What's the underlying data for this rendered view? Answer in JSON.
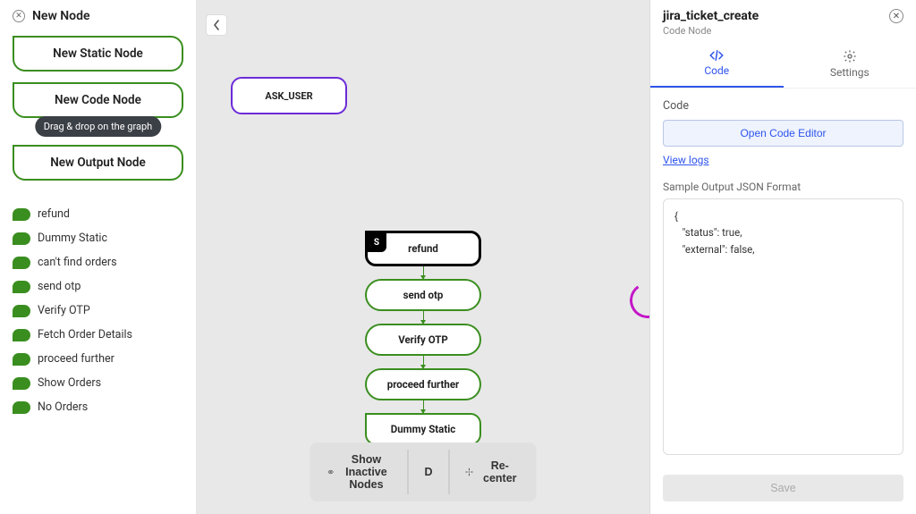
{
  "sidebar": {
    "title": "New Node",
    "buttons": {
      "static": "New Static Node",
      "code": "New Code Node",
      "output": "New Output Node"
    },
    "tooltip": "Drag & drop on the graph",
    "nodes": [
      "refund",
      "Dummy Static",
      "can't find orders",
      "send otp",
      "Verify OTP",
      "Fetch Order Details",
      "proceed further",
      "Show Orders",
      "No Orders"
    ]
  },
  "canvas": {
    "ask_user": "ASK_USER",
    "refund_tag": "S",
    "flow": [
      "refund",
      "send otp",
      "Verify OTP",
      "proceed further",
      "Dummy Static"
    ],
    "toolbar": {
      "inactive": "Show Inactive Nodes",
      "d": "D",
      "recenter": "Re-center"
    }
  },
  "right": {
    "title": "jira_ticket_create",
    "subtitle": "Code Node",
    "tabs": {
      "code": "Code",
      "settings": "Settings"
    },
    "section_label": "Code",
    "open_editor": "Open Code Editor",
    "view_logs": "View logs",
    "sample_label": "Sample Output JSON Format",
    "sample_json": "{\n   \"status\": true,\n   \"external\": false,",
    "save": "Save"
  }
}
